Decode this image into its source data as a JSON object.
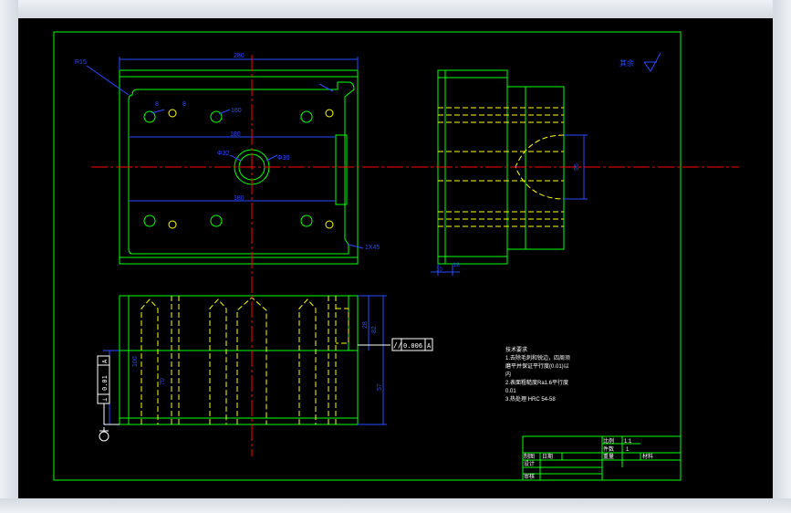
{
  "drawing": {
    "roughness_text": "其余",
    "plan_dims": {
      "width_top": "280",
      "radius_corner": "R15",
      "hole_dia_a": "8",
      "hole_dia_b": "8",
      "pitch_upper": "160",
      "center_span": "180",
      "bore_outer": "Φ32",
      "bore_inner": "Φ30",
      "width_bottom": "180",
      "chamfer": "1X45"
    },
    "side_dims": {
      "height": "96",
      "step_a": "10",
      "step_b": "18"
    },
    "front_dims": {
      "height_right": "82",
      "upper_part": "28",
      "lower_total": "57",
      "left_height": "100",
      "left_inner": "70"
    },
    "tolerance_frame": {
      "symbol": "//",
      "value": "0.006",
      "datum": "A"
    },
    "datum_left": {
      "symbol": "⊥",
      "value": "0.01",
      "datum": "A"
    },
    "notes": [
      "技术要求",
      "1.去除毛刺和锐边，四周须",
      "磨平并保证平行度(0.01)以",
      "内",
      "2.表面粗糙度Ra1.6平行度",
      "0.01",
      "3.热处理   HRC 54-58"
    ],
    "title_block": {
      "scale_label": "比例",
      "scale_value": "1:1",
      "count_label": "件数",
      "count_value": "1",
      "draw_label": "制图",
      "draw_value": "日期",
      "weight_label": "重量",
      "material_label": "材料",
      "design_label": "设计",
      "check_label": "审核"
    }
  },
  "colors": {
    "green": "#00ff00",
    "yellow": "#ffff00",
    "red": "#ff0000",
    "blue": "#2a4bff",
    "white": "#ffffff"
  }
}
